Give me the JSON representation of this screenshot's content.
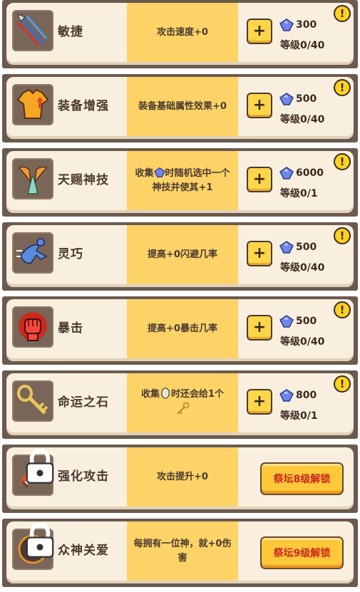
{
  "currency_icon": "blue-gem-icon",
  "alert_symbol": "!",
  "plus_symbol": "+",
  "colors": {
    "card_frame": "#6b5a4e",
    "card_bg": "#f8efdf",
    "desc_bg": "#fdd367",
    "button_yellow": "#ffd54a",
    "unlock_text": "#c8281e",
    "gem_blue": "#6f86e8"
  },
  "upgrades": [
    {
      "id": "agility",
      "icon": "spears-icon",
      "title": "敏捷",
      "desc": "攻击速度+0",
      "cost": "300",
      "level": "等级0/40",
      "locked": false
    },
    {
      "id": "equipment",
      "icon": "armor-shirt-icon",
      "title": "装备增强",
      "desc": "装备基础属性效果+0",
      "cost": "500",
      "level": "等级0/40",
      "locked": false
    },
    {
      "id": "divine_gift",
      "icon": "praying-hands-icon",
      "title": "天赐神技",
      "desc_before": "收集",
      "desc_after": "时随机选中一个神技并使其+1",
      "cost": "6000",
      "level": "等级0/1",
      "locked": false
    },
    {
      "id": "dexterity",
      "icon": "dodge-runner-icon",
      "title": "灵巧",
      "desc": "提高+0闪避几率",
      "cost": "500",
      "level": "等级0/40",
      "locked": false
    },
    {
      "id": "critical",
      "icon": "fist-icon",
      "title": "暴击",
      "desc": "提高+0暴击几率",
      "cost": "500",
      "level": "等级0/40",
      "locked": false
    },
    {
      "id": "fate_stone",
      "icon": "key-icon",
      "title": "命运之石",
      "desc_before": "收集",
      "desc_after": "时还会给1个",
      "cost": "800",
      "level": "等级0/1",
      "locked": false
    },
    {
      "id": "enhanced_attack",
      "icon": "flaming-sword-icon",
      "title": "强化攻击",
      "desc": "攻击提升+0",
      "unlock": "祭坛8级解锁",
      "locked": true
    },
    {
      "id": "gods_favor",
      "icon": "god-emblem-icon",
      "title": "众神关爱",
      "desc": "每拥有一位神，就+0伤害",
      "unlock": "祭坛9级解锁",
      "locked": true
    }
  ]
}
